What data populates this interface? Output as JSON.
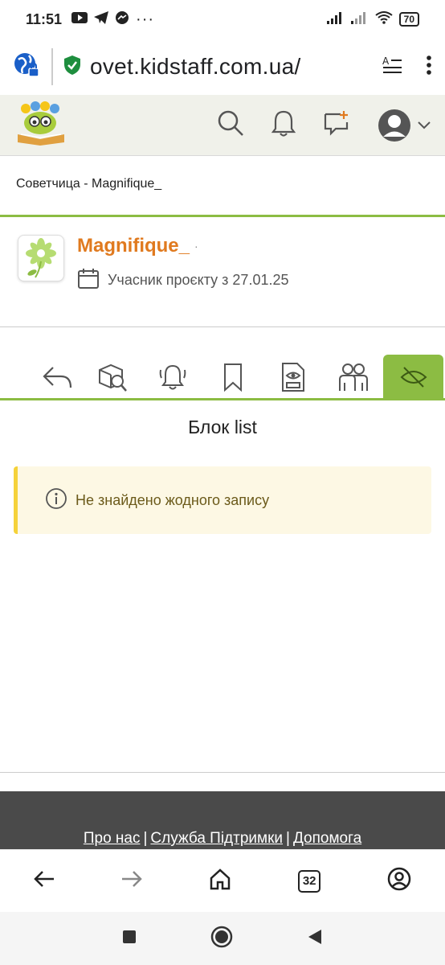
{
  "status_bar": {
    "time": "11:51",
    "dots": "···",
    "battery": "70"
  },
  "browser": {
    "url": "ovet.kidstaff.com.ua/"
  },
  "breadcrumb": "Советчица - Magnifique_",
  "profile": {
    "username": "Magnifique_",
    "online_marker": "·",
    "member_since": "Учасник проєкту з 27.01.25"
  },
  "tabs": [
    {
      "icon": "reply-icon"
    },
    {
      "icon": "box-search-icon"
    },
    {
      "icon": "bell-ringing-icon"
    },
    {
      "icon": "bookmark-icon"
    },
    {
      "icon": "document-eye-icon"
    },
    {
      "icon": "people-icon"
    },
    {
      "icon": "eye-off-icon",
      "active": true
    }
  ],
  "block_title": "Блок list",
  "notice": {
    "text": "Не знайдено жодного запису"
  },
  "footer": {
    "link_about": "Про нас",
    "link_support": "Служба Підтримки",
    "link_help": "Допомога",
    "separator": "|"
  },
  "browser_nav": {
    "tab_count": "32"
  },
  "colors": {
    "accent_green": "#8cbc43",
    "username_orange": "#e07a1f",
    "notice_bg": "#fdf8e4",
    "notice_border": "#f5d23a",
    "footer_bg": "#4a4a4a"
  }
}
